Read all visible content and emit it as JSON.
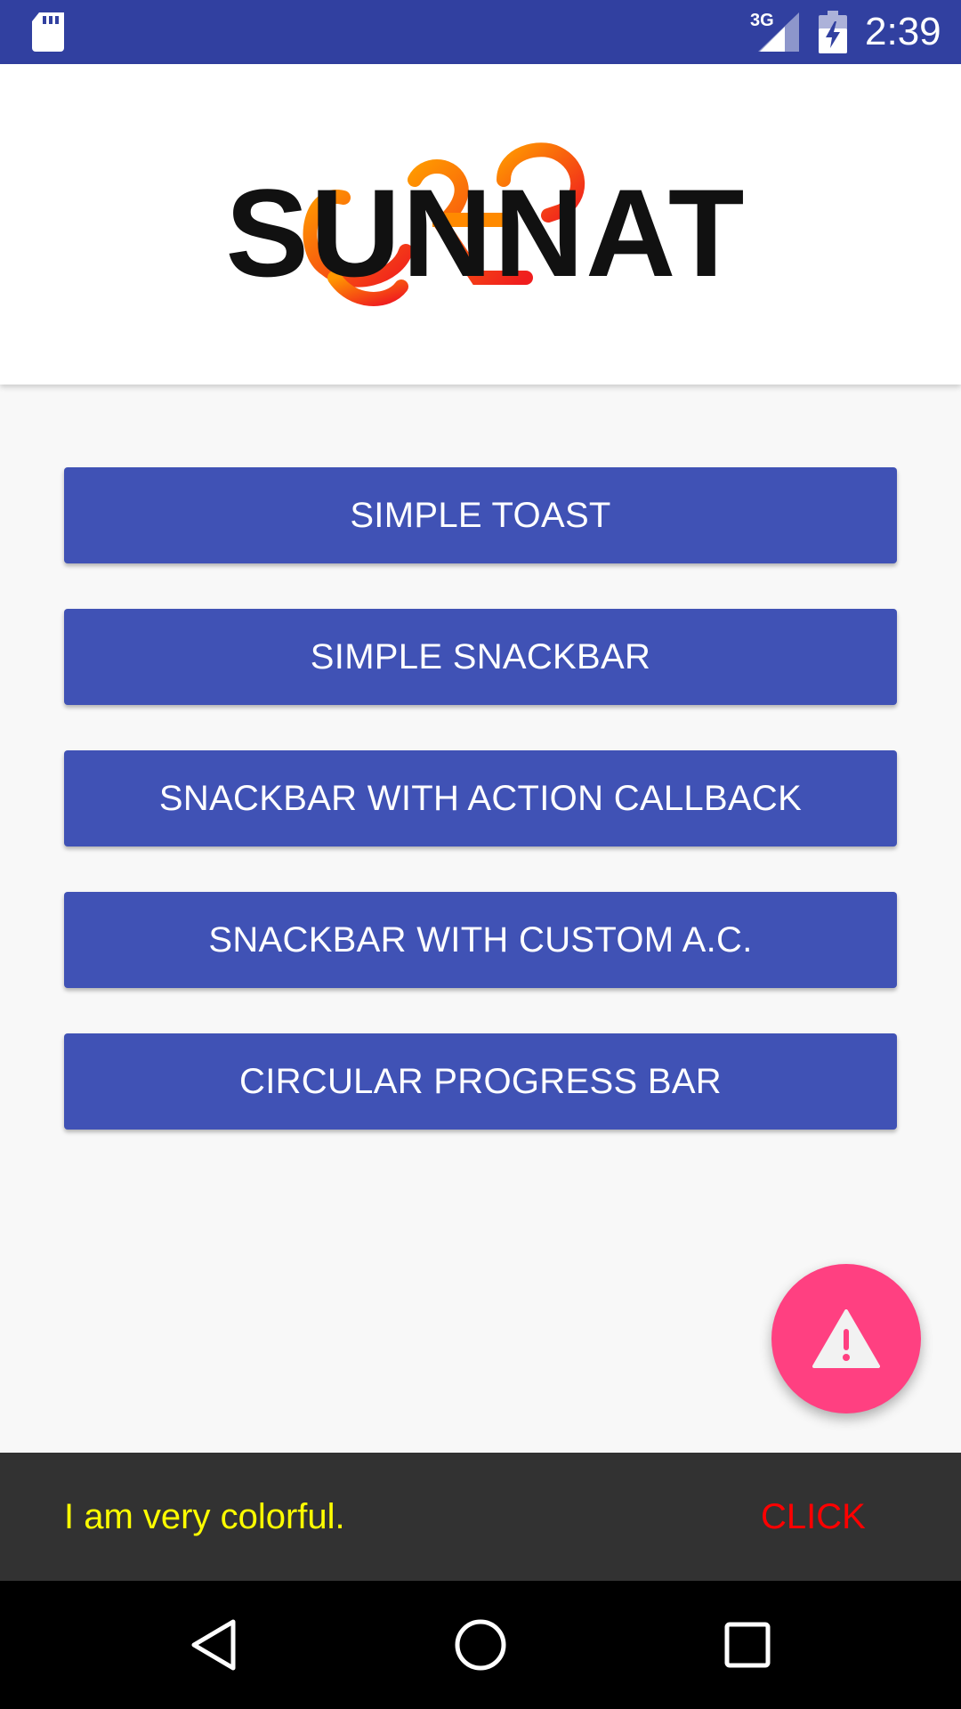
{
  "colors": {
    "status_bar": "#3140a0",
    "primary": "#4052b5",
    "accent": "#ff4081",
    "snackbar_bg": "#323232",
    "snackbar_text": "#ffff00",
    "snackbar_action": "#ff0000"
  },
  "status_bar": {
    "network_type": "3G",
    "time": "2:39",
    "icons": [
      "sd-card-icon",
      "signal-icon",
      "battery-charging-icon"
    ]
  },
  "header": {
    "logo_text": "SUNNAT"
  },
  "buttons": [
    {
      "label": "SIMPLE TOAST"
    },
    {
      "label": "SIMPLE SNACKBAR"
    },
    {
      "label": "SNACKBAR WITH ACTION CALLBACK"
    },
    {
      "label": "SNACKBAR WITH CUSTOM A.C."
    },
    {
      "label": "CIRCULAR PROGRESS BAR"
    }
  ],
  "fab": {
    "icon": "warning-icon"
  },
  "snackbar": {
    "message": "I am very colorful.",
    "action": "CLICK"
  },
  "navigation": {
    "icons": [
      "back-icon",
      "home-icon",
      "recents-icon"
    ]
  }
}
